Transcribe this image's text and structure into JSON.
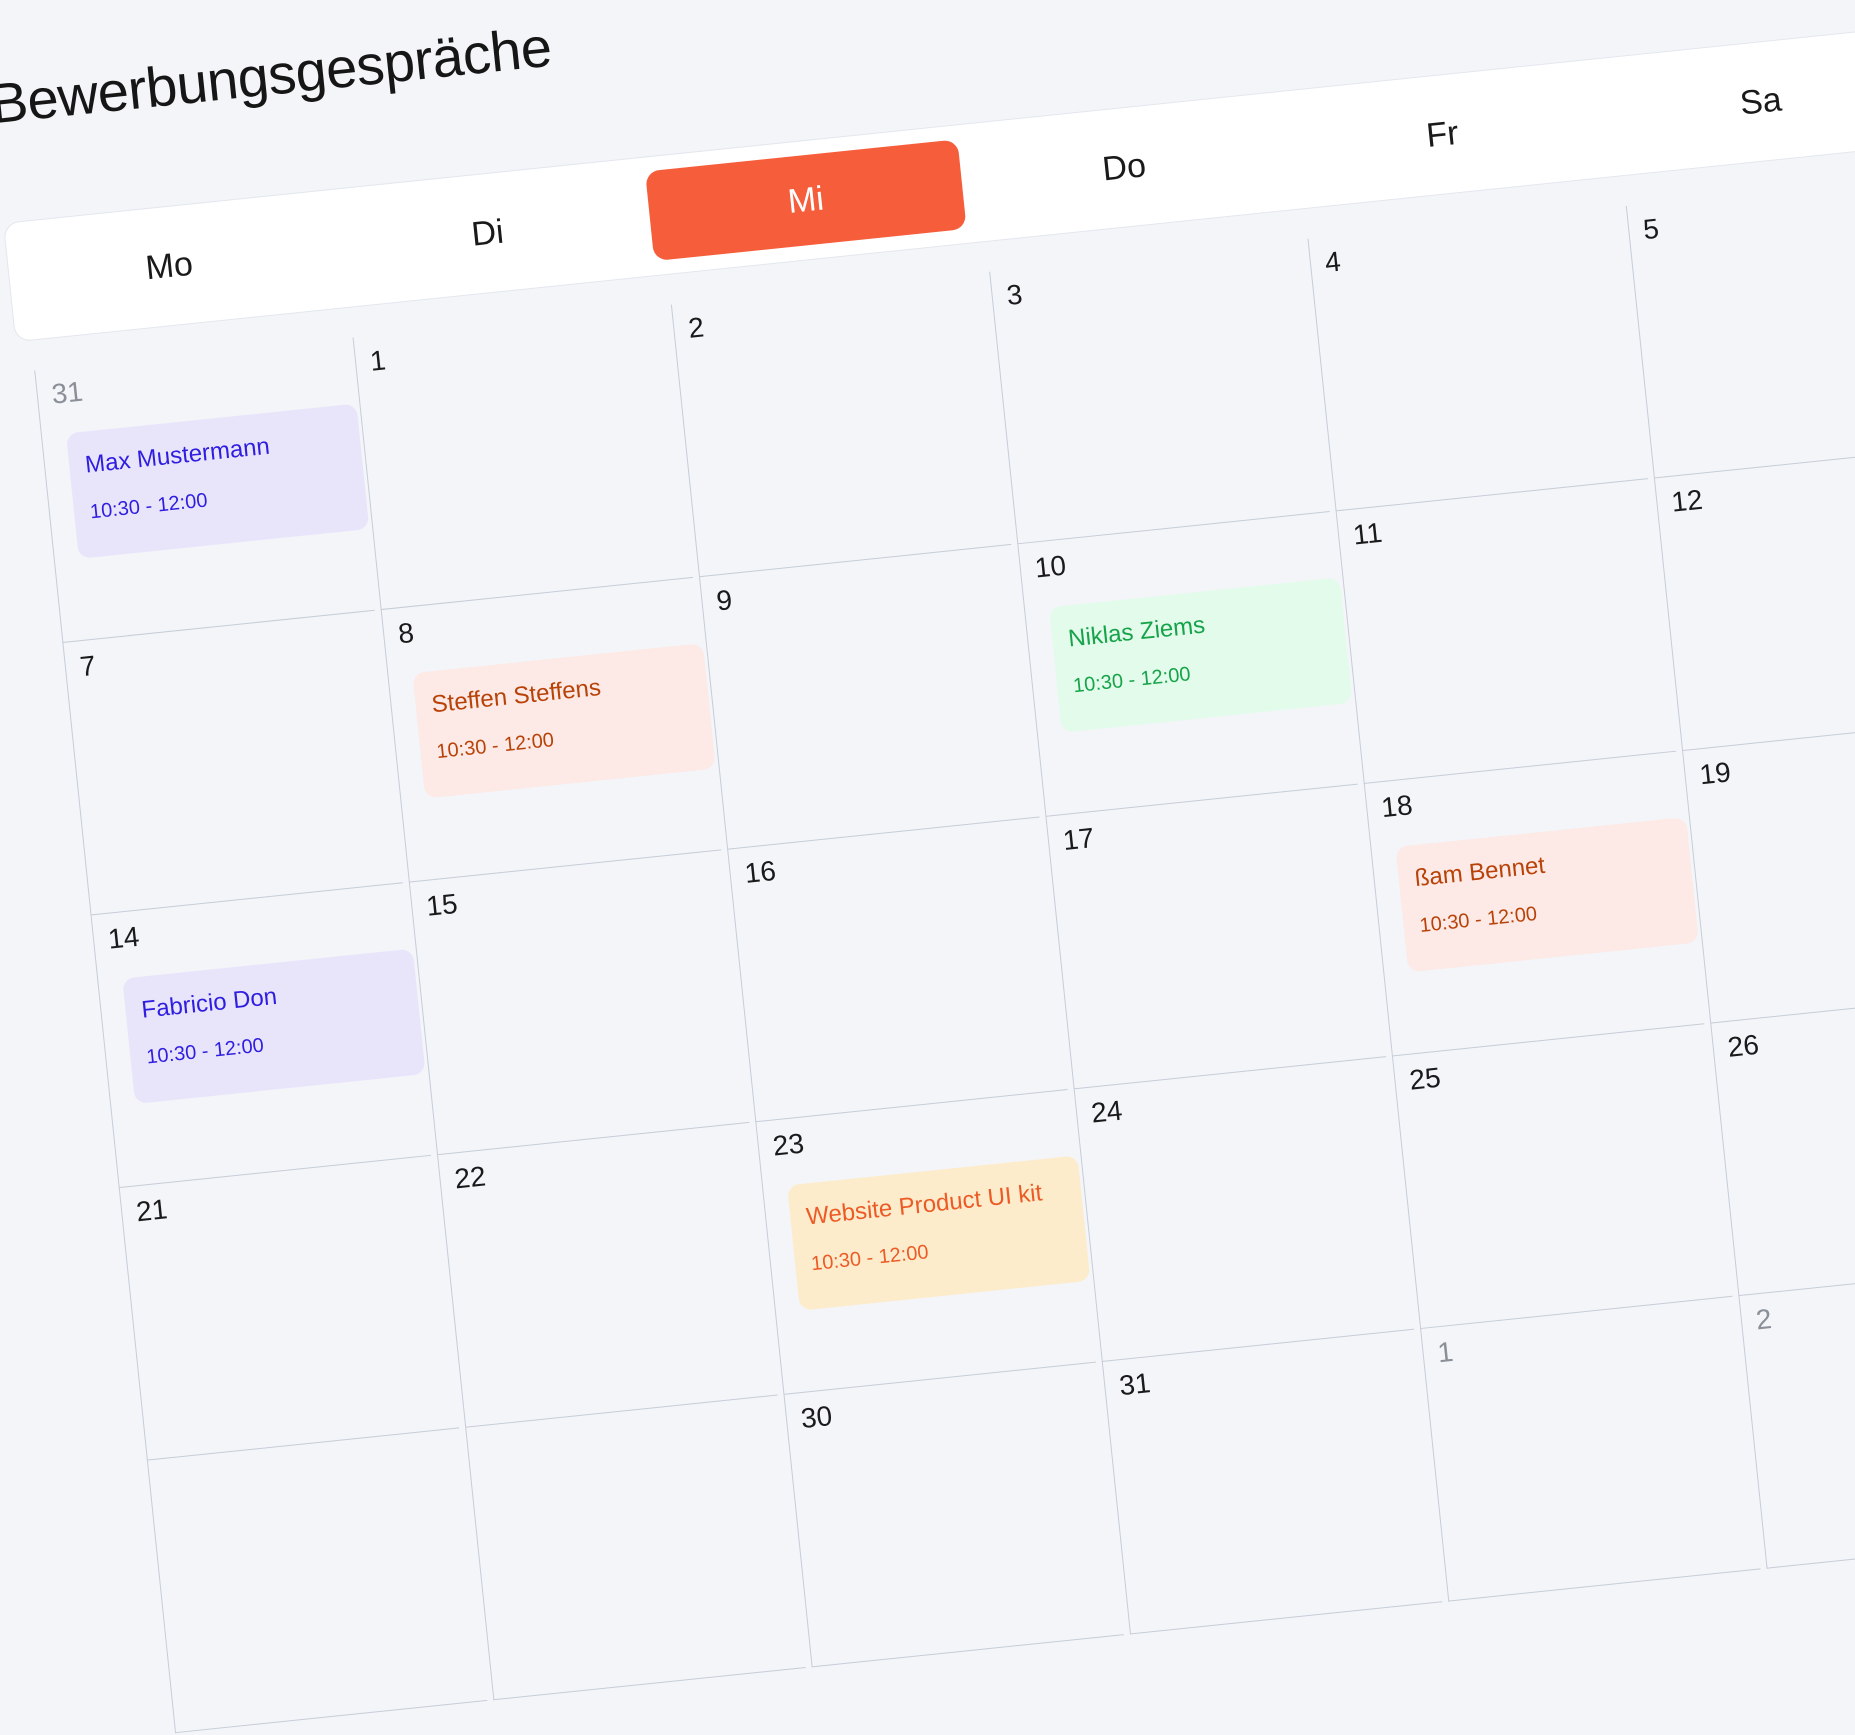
{
  "title": "Bewerbungsgespräche",
  "weekdays": [
    {
      "label": "Mo",
      "active": false
    },
    {
      "label": "Di",
      "active": false
    },
    {
      "label": "Mi",
      "active": true
    },
    {
      "label": "Do",
      "active": false
    },
    {
      "label": "Fr",
      "active": false
    },
    {
      "label": "Sa",
      "active": false
    }
  ],
  "weeks": [
    [
      {
        "day": "31",
        "muted": true,
        "event": {
          "name": "Max Mustermann",
          "time": "10:30 - 12:00",
          "color": "purple"
        }
      },
      {
        "day": "1"
      },
      {
        "day": "2"
      },
      {
        "day": "3"
      },
      {
        "day": "4"
      },
      {
        "day": "5"
      }
    ],
    [
      {
        "day": "7"
      },
      {
        "day": "8",
        "event": {
          "name": "Steffen Steffens",
          "time": "10:30 - 12:00",
          "color": "salmon"
        }
      },
      {
        "day": "9"
      },
      {
        "day": "10",
        "event": {
          "name": "Niklas Ziems",
          "time": "10:30 - 12:00",
          "color": "green"
        }
      },
      {
        "day": "11"
      },
      {
        "day": "12"
      }
    ],
    [
      {
        "day": "14",
        "event": {
          "name": "Fabricio Don",
          "time": "10:30 - 12:00",
          "color": "purple"
        }
      },
      {
        "day": "15"
      },
      {
        "day": "16"
      },
      {
        "day": "17"
      },
      {
        "day": "18",
        "event": {
          "name": "ßam Bennet",
          "time": "10:30 - 12:00",
          "color": "salmon"
        }
      },
      {
        "day": "19"
      }
    ],
    [
      {
        "day": "21"
      },
      {
        "day": "22"
      },
      {
        "day": "23",
        "event": {
          "name": "Website Product UI kit",
          "time": "10:30 - 12:00",
          "color": "orange"
        }
      },
      {
        "day": "24"
      },
      {
        "day": "25"
      },
      {
        "day": "26"
      }
    ],
    [
      {
        "day": ""
      },
      {
        "day": ""
      },
      {
        "day": "30"
      },
      {
        "day": "31"
      },
      {
        "day": "1",
        "muted": true
      },
      {
        "day": "2",
        "muted": true
      }
    ]
  ],
  "colors": {
    "accent": "#f65d3a",
    "purple": "#2f1ee0",
    "salmon": "#b84208",
    "green": "#16a34a",
    "orange": "#ec5b26"
  }
}
